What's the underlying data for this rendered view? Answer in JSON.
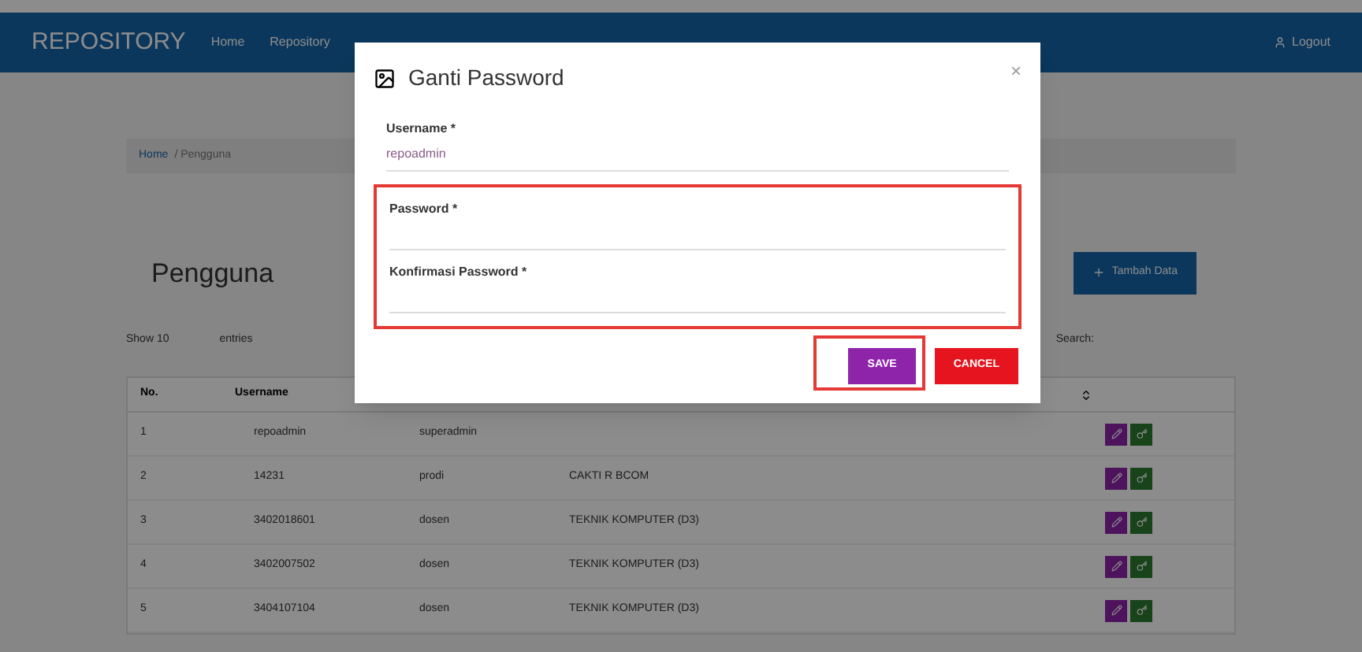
{
  "navbar": {
    "brand": "REPOSITORY",
    "links": [
      "Home",
      "Repository"
    ],
    "user": "Logout"
  },
  "breadcrumb": [
    "Home",
    "/ Pengguna"
  ],
  "page_title": "Pengguna",
  "add_button": "Tambah Data",
  "table_controls": {
    "show": "Show 10",
    "entries": "entries",
    "search": "Search:"
  },
  "table": {
    "columns": [
      "No.",
      "Username"
    ],
    "rows": [
      {
        "cells": [
          "1",
          "repoadmin",
          "superadmin",
          ""
        ]
      },
      {
        "cells": [
          "2",
          "14231",
          "prodi",
          "CAKTI R BCOM"
        ]
      },
      {
        "cells": [
          "3",
          "3402018601",
          "dosen",
          "TEKNIK KOMPUTER (D3)"
        ]
      },
      {
        "cells": [
          "4",
          "3402007502",
          "dosen",
          "TEKNIK KOMPUTER (D3)"
        ]
      },
      {
        "cells": [
          "5",
          "3404107104",
          "dosen",
          "TEKNIK KOMPUTER (D3)"
        ]
      }
    ]
  },
  "modal": {
    "title": "Ganti Password",
    "close": "×",
    "password_group_highlighted": true,
    "fields": [
      {
        "kind": "readonly",
        "label": "Username *",
        "value": "repoadmin"
      },
      {
        "kind": "password",
        "label": "Password *"
      },
      {
        "kind": "password",
        "label": "Konfirmasi Password *"
      }
    ],
    "save_button_highlighted": true,
    "buttons": [
      {
        "kind": "save",
        "label": "SAVE"
      },
      {
        "kind": "cancel",
        "label": "CANCEL"
      }
    ]
  }
}
